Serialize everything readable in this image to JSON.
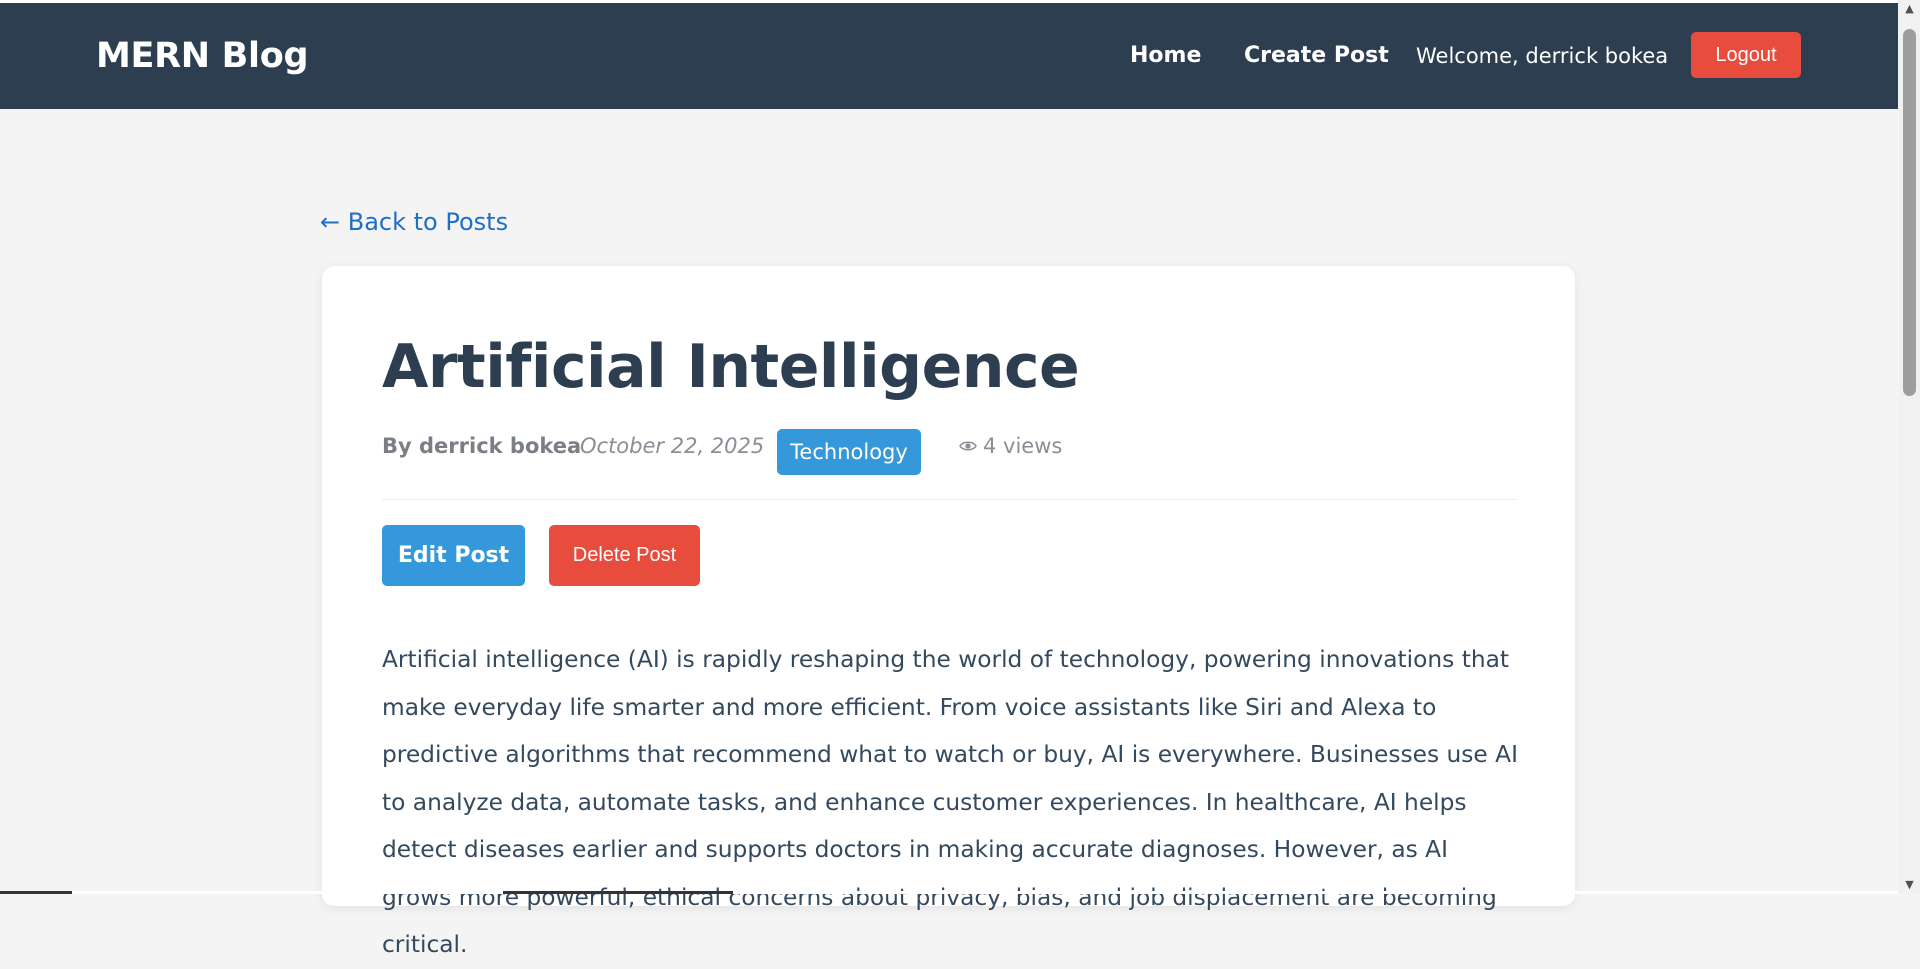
{
  "navbar": {
    "brand": "MERN Blog",
    "links": [
      {
        "label": "Home"
      },
      {
        "label": "Create Post"
      }
    ],
    "welcome": "Welcome, derrick bokea",
    "logout_label": "Logout"
  },
  "back_link": "← Back to Posts",
  "post": {
    "title": "Artificial Intelligence",
    "author": "By derrick bokea",
    "date": "October 22, 2025",
    "category": "Technology",
    "views": "4 views",
    "edit_label": "Edit Post",
    "delete_label": "Delete Post",
    "content": "Artificial intelligence (AI) is rapidly reshaping the world of technology, powering innovations that make everyday life smarter and more efficient. From voice assistants like Siri and Alexa to predictive algorithms that recommend what to watch or buy, AI is everywhere. Businesses use AI to analyze data, automate tasks, and enhance customer experiences. In healthcare, AI helps detect diseases earlier and supports doctors in making accurate diagnoses. However, as AI grows more powerful, ethical concerns about privacy, bias, and job displacement are becoming critical."
  },
  "colors": {
    "navbar": "#2c3e50",
    "accent": "#3498db",
    "danger": "#e74c3c",
    "link": "#1f6fc4",
    "background": "#f4f4f4"
  },
  "icons": {
    "views": "eye-icon"
  }
}
